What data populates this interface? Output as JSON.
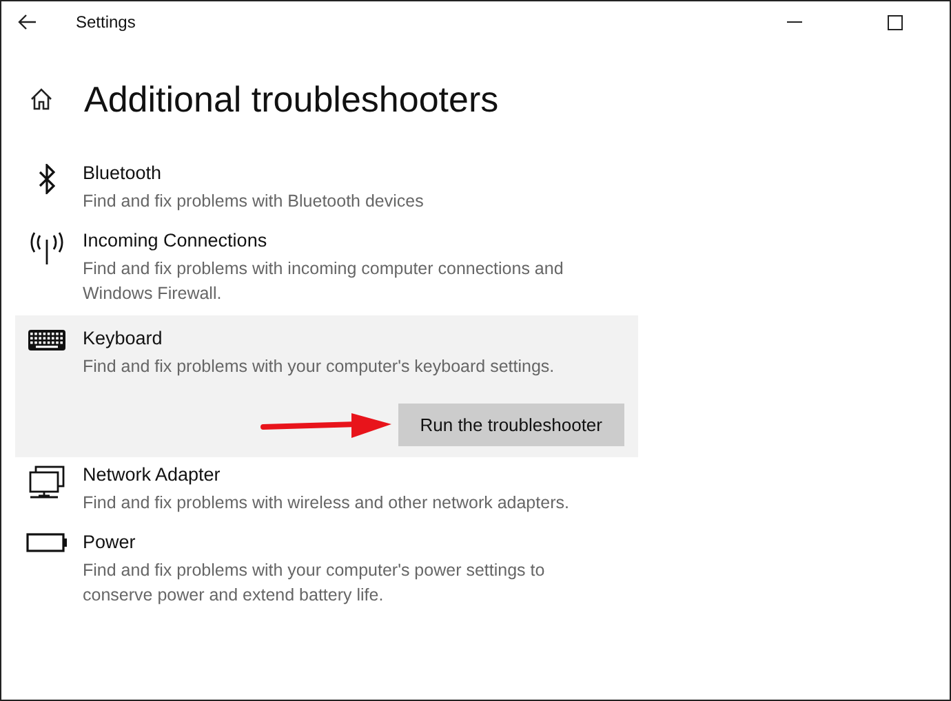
{
  "window": {
    "title": "Settings"
  },
  "page": {
    "title": "Additional troubleshooters"
  },
  "troubleshooters": [
    {
      "kind": "bluetooth",
      "name": "Bluetooth",
      "description": "Find and fix problems with Bluetooth devices",
      "expanded": false
    },
    {
      "kind": "antenna",
      "name": "Incoming Connections",
      "description": "Find and fix problems with incoming computer connections and Windows Firewall.",
      "expanded": false
    },
    {
      "kind": "keyboard",
      "name": "Keyboard",
      "description": "Find and fix problems with your computer's keyboard settings.",
      "expanded": true,
      "button": "Run the troubleshooter"
    },
    {
      "kind": "network",
      "name": "Network Adapter",
      "description": "Find and fix problems with wireless and other network adapters.",
      "expanded": false
    },
    {
      "kind": "battery",
      "name": "Power",
      "description": "Find and fix problems with your computer's power settings to conserve power and extend battery life.",
      "expanded": false
    }
  ]
}
